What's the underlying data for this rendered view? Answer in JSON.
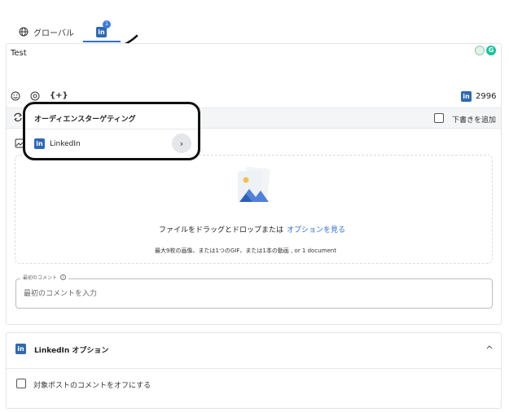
{
  "tabs": [
    {
      "label": "グローバル",
      "icon": "globe-icon"
    },
    {
      "label": "",
      "icon": "linkedin-icon",
      "badge": "1"
    }
  ],
  "editor": {
    "text": "Test",
    "char_count": "2996",
    "variables_label": "{+}",
    "draft_label": "下書きを追加"
  },
  "popup": {
    "title": "オーディエンスターゲティング",
    "item_label": "LinkedIn"
  },
  "dropzone": {
    "drag_text": "ファイルをドラッグとドロップまたは",
    "options_link": "オプションを見る",
    "limits_text": "最大9枚の画像、または1つのGIF、または1本の動画 , or 1 document"
  },
  "first_comment": {
    "label": "最初のコメント",
    "placeholder": "最初のコメントを入力"
  },
  "linkedin_options": {
    "title": "LinkedIn オプション",
    "checkbox_label": "対象ポストのコメントをオフにする"
  },
  "colors": {
    "linkedin": "#2f69b3",
    "accent": "#2f6fd0",
    "grammarly": "#15c39a"
  }
}
